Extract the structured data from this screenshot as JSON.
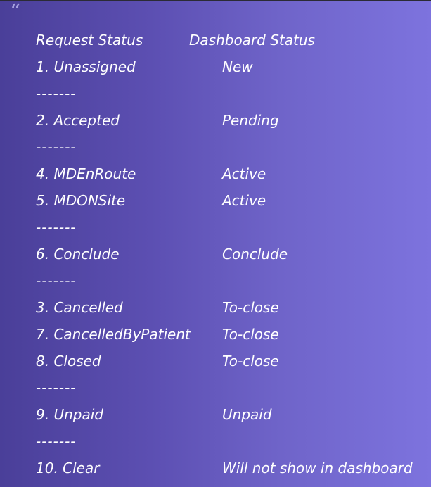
{
  "quote": {
    "icon": "quote-open-icon",
    "header": {
      "left": "Request Status",
      "right": "Dashboard Status"
    },
    "separator": "-------",
    "rows": [
      {
        "left": "1. Unassigned",
        "right": "New"
      },
      {
        "left": "-------",
        "right": ""
      },
      {
        "left": "2. Accepted",
        "right": "Pending"
      },
      {
        "left": "-------",
        "right": ""
      },
      {
        "left": "4. MDEnRoute",
        "right": "Active"
      },
      {
        "left": "5. MDONSite",
        "right": "Active"
      },
      {
        "left": "-------",
        "right": ""
      },
      {
        "left": "6. Conclude",
        "right": "Conclude"
      },
      {
        "left": "-------",
        "right": ""
      },
      {
        "left": "3. Cancelled",
        "right": "To-close"
      },
      {
        "left": "7. CancelledByPatient",
        "right": "To-close"
      },
      {
        "left": "8. Closed",
        "right": "To-close"
      },
      {
        "left": "-------",
        "right": ""
      },
      {
        "left": "9. Unpaid",
        "right": "Unpaid"
      },
      {
        "left": "-------",
        "right": ""
      },
      {
        "left": "10. Clear",
        "right": "Will not show in dashboard"
      }
    ],
    "colors": {
      "gradient_start": "#4a3f99",
      "gradient_end": "#7d73de",
      "text": "#ffffff",
      "icon": "#a7a2e0",
      "top_border": "#2b2b36"
    }
  }
}
